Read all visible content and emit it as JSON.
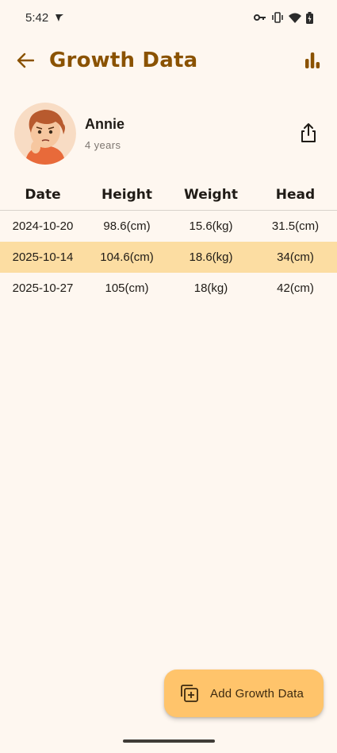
{
  "status_bar": {
    "time": "5:42"
  },
  "app_bar": {
    "title": "Growth Data"
  },
  "profile": {
    "name": "Annie",
    "age": "4 years"
  },
  "table": {
    "headers": [
      "Date",
      "Height",
      "Weight",
      "Head"
    ],
    "rows": [
      {
        "date": "2024-10-20",
        "height": "98.6(cm)",
        "weight": "15.6(kg)",
        "head": "31.5(cm)"
      },
      {
        "date": "2025-10-14",
        "height": "104.6(cm)",
        "weight": "18.6(kg)",
        "head": "34(cm)"
      },
      {
        "date": "2025-10-27",
        "height": "105(cm)",
        "weight": "18(kg)",
        "head": "42(cm)"
      }
    ]
  },
  "fab": {
    "label": "Add Growth Data"
  },
  "colors": {
    "accent": "#8a5200",
    "fab": "#ffc46b",
    "highlight": "#fcdda2",
    "background": "#fef7f0"
  },
  "icons": [
    "back-arrow-icon",
    "bar-chart-icon",
    "share-icon",
    "add-note-icon"
  ]
}
